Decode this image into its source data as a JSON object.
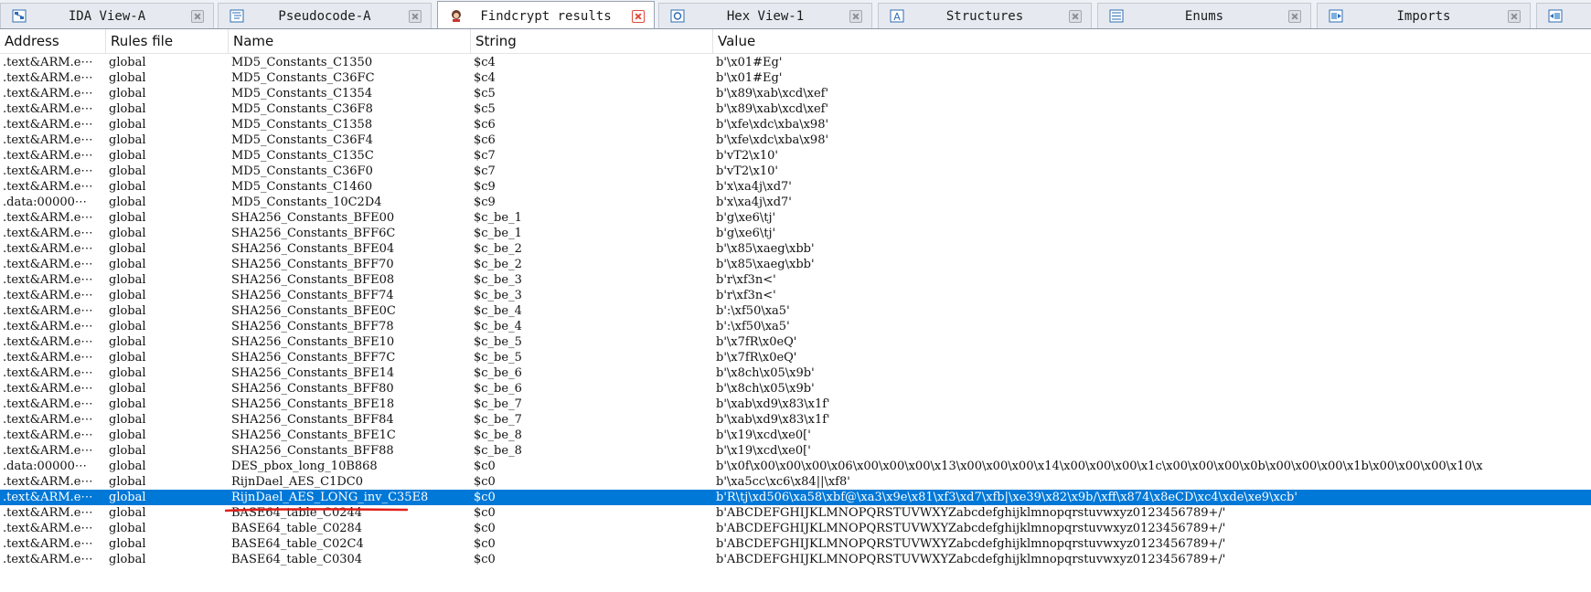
{
  "tabs": [
    {
      "label": "IDA View-A",
      "icon": "graph-view-icon",
      "active": false
    },
    {
      "label": "Pseudocode-A",
      "icon": "pseudocode-icon",
      "active": false
    },
    {
      "label": "Findcrypt results",
      "icon": "findcrypt-icon",
      "active": true
    },
    {
      "label": "Hex View-1",
      "icon": "hex-view-icon",
      "active": false
    },
    {
      "label": "Structures",
      "icon": "structures-icon",
      "active": false
    },
    {
      "label": "Enums",
      "icon": "enums-icon",
      "active": false
    },
    {
      "label": "Imports",
      "icon": "imports-icon",
      "active": false
    }
  ],
  "columns": {
    "address": "Address",
    "rules": "Rules file",
    "name": "Name",
    "string": "String",
    "value": "Value"
  },
  "rows": [
    {
      "address": ".text&ARM.e⋯",
      "rules": "global",
      "name": "MD5_Constants_C1350",
      "string": "$c4",
      "value": "b'\\x01#Eg'"
    },
    {
      "address": ".text&ARM.e⋯",
      "rules": "global",
      "name": "MD5_Constants_C36FC",
      "string": "$c4",
      "value": "b'\\x01#Eg'"
    },
    {
      "address": ".text&ARM.e⋯",
      "rules": "global",
      "name": "MD5_Constants_C1354",
      "string": "$c5",
      "value": "b'\\x89\\xab\\xcd\\xef'"
    },
    {
      "address": ".text&ARM.e⋯",
      "rules": "global",
      "name": "MD5_Constants_C36F8",
      "string": "$c5",
      "value": "b'\\x89\\xab\\xcd\\xef'"
    },
    {
      "address": ".text&ARM.e⋯",
      "rules": "global",
      "name": "MD5_Constants_C1358",
      "string": "$c6",
      "value": "b'\\xfe\\xdc\\xba\\x98'"
    },
    {
      "address": ".text&ARM.e⋯",
      "rules": "global",
      "name": "MD5_Constants_C36F4",
      "string": "$c6",
      "value": "b'\\xfe\\xdc\\xba\\x98'"
    },
    {
      "address": ".text&ARM.e⋯",
      "rules": "global",
      "name": "MD5_Constants_C135C",
      "string": "$c7",
      "value": "b'vT2\\x10'"
    },
    {
      "address": ".text&ARM.e⋯",
      "rules": "global",
      "name": "MD5_Constants_C36F0",
      "string": "$c7",
      "value": "b'vT2\\x10'"
    },
    {
      "address": ".text&ARM.e⋯",
      "rules": "global",
      "name": "MD5_Constants_C1460",
      "string": "$c9",
      "value": "b'x\\xa4j\\xd7'"
    },
    {
      "address": ".data:00000⋯",
      "rules": "global",
      "name": "MD5_Constants_10C2D4",
      "string": "$c9",
      "value": "b'x\\xa4j\\xd7'"
    },
    {
      "address": ".text&ARM.e⋯",
      "rules": "global",
      "name": "SHA256_Constants_BFE00",
      "string": "$c_be_1",
      "value": "b'g\\xe6\\tj'"
    },
    {
      "address": ".text&ARM.e⋯",
      "rules": "global",
      "name": "SHA256_Constants_BFF6C",
      "string": "$c_be_1",
      "value": "b'g\\xe6\\tj'"
    },
    {
      "address": ".text&ARM.e⋯",
      "rules": "global",
      "name": "SHA256_Constants_BFE04",
      "string": "$c_be_2",
      "value": "b'\\x85\\xaeg\\xbb'"
    },
    {
      "address": ".text&ARM.e⋯",
      "rules": "global",
      "name": "SHA256_Constants_BFF70",
      "string": "$c_be_2",
      "value": "b'\\x85\\xaeg\\xbb'"
    },
    {
      "address": ".text&ARM.e⋯",
      "rules": "global",
      "name": "SHA256_Constants_BFE08",
      "string": "$c_be_3",
      "value": "b'r\\xf3n<'"
    },
    {
      "address": ".text&ARM.e⋯",
      "rules": "global",
      "name": "SHA256_Constants_BFF74",
      "string": "$c_be_3",
      "value": "b'r\\xf3n<'"
    },
    {
      "address": ".text&ARM.e⋯",
      "rules": "global",
      "name": "SHA256_Constants_BFE0C",
      "string": "$c_be_4",
      "value": "b':\\xf50\\xa5'"
    },
    {
      "address": ".text&ARM.e⋯",
      "rules": "global",
      "name": "SHA256_Constants_BFF78",
      "string": "$c_be_4",
      "value": "b':\\xf50\\xa5'"
    },
    {
      "address": ".text&ARM.e⋯",
      "rules": "global",
      "name": "SHA256_Constants_BFE10",
      "string": "$c_be_5",
      "value": "b'\\x7fR\\x0eQ'"
    },
    {
      "address": ".text&ARM.e⋯",
      "rules": "global",
      "name": "SHA256_Constants_BFF7C",
      "string": "$c_be_5",
      "value": "b'\\x7fR\\x0eQ'"
    },
    {
      "address": ".text&ARM.e⋯",
      "rules": "global",
      "name": "SHA256_Constants_BFE14",
      "string": "$c_be_6",
      "value": "b'\\x8ch\\x05\\x9b'"
    },
    {
      "address": ".text&ARM.e⋯",
      "rules": "global",
      "name": "SHA256_Constants_BFF80",
      "string": "$c_be_6",
      "value": "b'\\x8ch\\x05\\x9b'"
    },
    {
      "address": ".text&ARM.e⋯",
      "rules": "global",
      "name": "SHA256_Constants_BFE18",
      "string": "$c_be_7",
      "value": "b'\\xab\\xd9\\x83\\x1f'"
    },
    {
      "address": ".text&ARM.e⋯",
      "rules": "global",
      "name": "SHA256_Constants_BFF84",
      "string": "$c_be_7",
      "value": "b'\\xab\\xd9\\x83\\x1f'"
    },
    {
      "address": ".text&ARM.e⋯",
      "rules": "global",
      "name": "SHA256_Constants_BFE1C",
      "string": "$c_be_8",
      "value": "b'\\x19\\xcd\\xe0['"
    },
    {
      "address": ".text&ARM.e⋯",
      "rules": "global",
      "name": "SHA256_Constants_BFF88",
      "string": "$c_be_8",
      "value": "b'\\x19\\xcd\\xe0['"
    },
    {
      "address": ".data:00000⋯",
      "rules": "global",
      "name": "DES_pbox_long_10B868",
      "string": "$c0",
      "value": "b'\\x0f\\x00\\x00\\x00\\x06\\x00\\x00\\x00\\x13\\x00\\x00\\x00\\x14\\x00\\x00\\x00\\x1c\\x00\\x00\\x00\\x0b\\x00\\x00\\x00\\x1b\\x00\\x00\\x00\\x10\\x"
    },
    {
      "address": ".text&ARM.e⋯",
      "rules": "global",
      "name": "RijnDael_AES_C1DC0",
      "string": "$c0",
      "value": "b'\\xa5cc\\xc6\\x84||\\xf8'"
    },
    {
      "address": ".text&ARM.e⋯",
      "rules": "global",
      "name": "RijnDael_AES_LONG_inv_C35E8",
      "string": "$c0",
      "value": "b'R\\tj\\xd506\\xa58\\xbf@\\xa3\\x9e\\x81\\xf3\\xd7\\xfb|\\xe39\\x82\\x9b/\\xff\\x874\\x8eCD\\xc4\\xde\\xe9\\xcb'",
      "selected": true
    },
    {
      "address": ".text&ARM.e⋯",
      "rules": "global",
      "name": "BASE64_table_C0244",
      "string": "$c0",
      "value": "b'ABCDEFGHIJKLMNOPQRSTUVWXYZabcdefghijklmnopqrstuvwxyz0123456789+/'"
    },
    {
      "address": ".text&ARM.e⋯",
      "rules": "global",
      "name": "BASE64_table_C0284",
      "string": "$c0",
      "value": "b'ABCDEFGHIJKLMNOPQRSTUVWXYZabcdefghijklmnopqrstuvwxyz0123456789+/'"
    },
    {
      "address": ".text&ARM.e⋯",
      "rules": "global",
      "name": "BASE64_table_C02C4",
      "string": "$c0",
      "value": "b'ABCDEFGHIJKLMNOPQRSTUVWXYZabcdefghijklmnopqrstuvwxyz0123456789+/'"
    },
    {
      "address": ".text&ARM.e⋯",
      "rules": "global",
      "name": "BASE64_table_C0304",
      "string": "$c0",
      "value": "b'ABCDEFGHIJKLMNOPQRSTUVWXYZabcdefghijklmnopqrstuvwxyz0123456789+/'"
    }
  ],
  "colors": {
    "selection": "#0078d7",
    "annotation": "#e0201c",
    "close_active": "#e04b3a"
  }
}
